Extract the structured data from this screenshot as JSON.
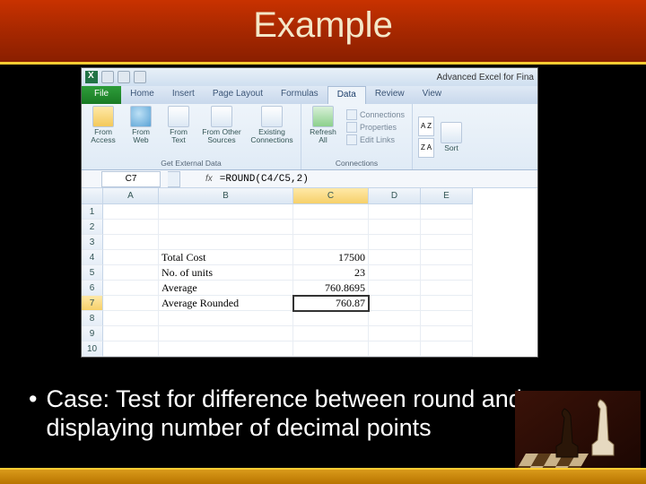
{
  "slide": {
    "title": "Example",
    "bullet_prefix": "•",
    "bullet_text": "Case: Test for difference between round and displaying number of decimal points"
  },
  "excel": {
    "window_title": "Advanced Excel for Fina",
    "tabs": {
      "file": "File",
      "home": "Home",
      "insert": "Insert",
      "page_layout": "Page Layout",
      "formulas": "Formulas",
      "data": "Data",
      "review": "Review",
      "view": "View"
    },
    "ribbon": {
      "from_access": "From\nAccess",
      "from_web": "From\nWeb",
      "from_text": "From\nText",
      "from_other": "From Other\nSources",
      "existing_conn": "Existing\nConnections",
      "get_external": "Get External Data",
      "refresh_all": "Refresh\nAll",
      "connections": "Connections",
      "properties": "Properties",
      "edit_links": "Edit Links",
      "conn_group": "Connections",
      "sort_az": "A\nZ",
      "sort_za": "Z\nA",
      "sort": "Sort"
    },
    "name_box": "C7",
    "fx_label": "fx",
    "formula": "=ROUND(C4/C5,2)",
    "columns": [
      "A",
      "B",
      "C",
      "D",
      "E"
    ],
    "row_numbers": [
      "1",
      "2",
      "3",
      "4",
      "5",
      "6",
      "7",
      "8",
      "9",
      "10"
    ],
    "cells": {
      "b4": "Total Cost",
      "c4": "17500",
      "b5": "No. of units",
      "c5": "23",
      "b6": "Average",
      "c6": "760.8695",
      "b7": "Average Rounded",
      "c7": "760.87"
    }
  }
}
